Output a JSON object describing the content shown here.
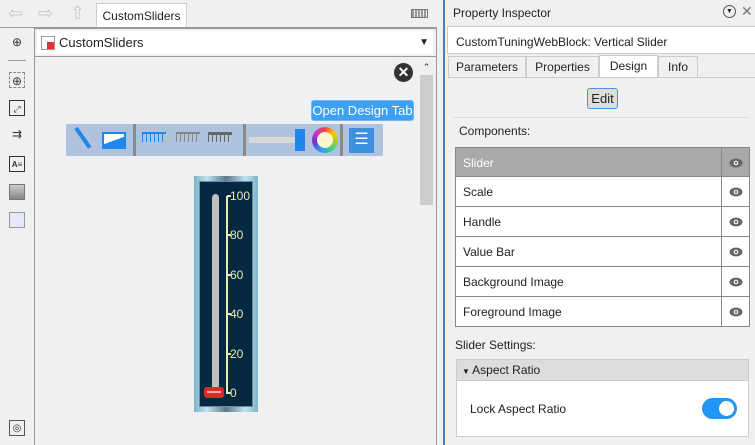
{
  "editor": {
    "tab": "CustomSliders",
    "address": "CustomSliders",
    "tooltip": "Open Design Tab"
  },
  "slider": {
    "ticks": [
      "100",
      "80",
      "60",
      "40",
      "20",
      "0"
    ],
    "value": 0
  },
  "inspector": {
    "title": "Property Inspector",
    "block_title": "CustomTuningWebBlock: Vertical Slider",
    "tabs": [
      "Parameters",
      "Properties",
      "Design",
      "Info"
    ],
    "active_tab": "Design",
    "edit": "Edit",
    "components_label": "Components:",
    "components": [
      "Slider",
      "Scale",
      "Handle",
      "Value Bar",
      "Background Image",
      "Foreground Image"
    ],
    "settings_label": "Slider Settings:",
    "section": "Aspect Ratio",
    "lock_label": "Lock Aspect Ratio",
    "lock_on": true
  },
  "colors": {
    "accent": "#3ea0f2",
    "toggle": "#2196f3"
  }
}
